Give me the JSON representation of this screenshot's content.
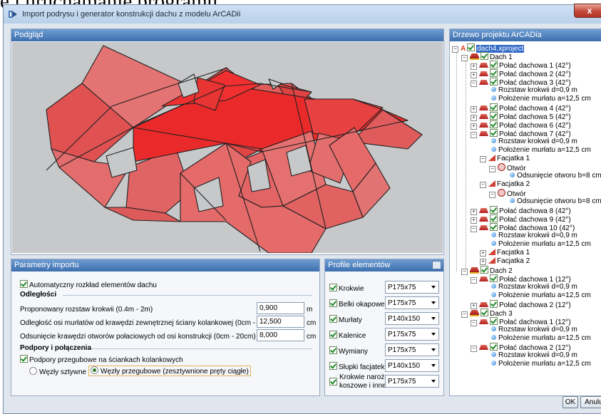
{
  "background_text": "e i urucnamanie programu",
  "window": {
    "title": "Import podrysu i generator konstrukcji dachu z modelu ArCADii",
    "close_label": "x"
  },
  "preview": {
    "title": "Podgląd",
    "colors": {
      "background": "#c7c8ca",
      "roof": "#e21d1d"
    }
  },
  "tree": {
    "title": "Drzewo projektu ArCADia",
    "nodes": [
      {
        "label": "dach4.xproject"
      },
      {
        "label": "Dach 1"
      },
      {
        "label": "Połać dachowa 1 (42°)"
      },
      {
        "label": "Połać dachowa 2 (42°)"
      },
      {
        "label": "Połać dachowa 3 (42°)"
      },
      {
        "label": "Rozstaw krokwii d=0,9 m"
      },
      {
        "label": "Położenie murłatu a=12,5 cm"
      },
      {
        "label": "Połać dachowa 4 (42°)"
      },
      {
        "label": "Połać dachowa 5 (42°)"
      },
      {
        "label": "Połać dachowa 6 (42°)"
      },
      {
        "label": "Połać dachowa 7 (42°)"
      },
      {
        "label": "Rozstaw krokwii d=0,9 m"
      },
      {
        "label": "Położenie murłatu a=12,5 cm"
      },
      {
        "label": "Facjatka 1"
      },
      {
        "label": "Otwór"
      },
      {
        "label": "Odsunięcie otworu b=8 cm"
      },
      {
        "label": "Facjatka 2"
      },
      {
        "label": "Otwór"
      },
      {
        "label": "Odsunięcie otworu b=8 cm"
      },
      {
        "label": "Połać dachowa 8 (42°)"
      },
      {
        "label": "Połać dachowa 9 (42°)"
      },
      {
        "label": "Połać dachowa 10 (42°)"
      },
      {
        "label": "Rozstaw krokwii d=0,9 m"
      },
      {
        "label": "Położenie murłatu a=12,5 cm"
      },
      {
        "label": "Facjatka 1"
      },
      {
        "label": "Facjatka 2"
      },
      {
        "label": "Dach 2"
      },
      {
        "label": "Połać dachowa 1 (12°)"
      },
      {
        "label": "Rozstaw krokwii d=0,9 m"
      },
      {
        "label": "Położenie murłatu a=12,5 cm"
      },
      {
        "label": "Połać dachowa 2 (12°)"
      },
      {
        "label": "Dach 3"
      },
      {
        "label": "Połać dachowa 1 (12°)"
      },
      {
        "label": "Rozstaw krokwii d=0,9 m"
      },
      {
        "label": "Położenie murłatu a=12,5 cm"
      },
      {
        "label": "Połać dachowa 2 (12°)"
      },
      {
        "label": "Rozstaw krokwii d=0,9 m"
      },
      {
        "label": "Położenie murłatu a=12,5 cm"
      }
    ]
  },
  "params": {
    "title": "Parametry importu",
    "auto_layout": "Automatyczny rozkład elementów dachu",
    "distances_heading": "Odległości",
    "rows": [
      {
        "label": "Proponowany rozstaw krokwii (0.4m - 2m)",
        "value": "0,900",
        "unit": "m"
      },
      {
        "label": "Odległość osi murłatów od krawędzi zewnętrznej ściany kolankowej (0cm - 100cm)",
        "value": "12,500",
        "unit": "cm"
      },
      {
        "label": "Odsunięcie krawędzi otworów połaciowych od osi konstrukcji (0cm - 20cm)",
        "value": "8,000",
        "unit": "cm"
      }
    ],
    "supports_heading": "Podpory i połączenia",
    "hinged_supports": "Podpory przegubowe na ściankach kolankowych",
    "radio_rigid": "Węzły sztywne",
    "radio_hinged": "Węzły przegubowe (zesztywnione pręty ciągłe)"
  },
  "profiles": {
    "title": "Profile elementów",
    "items": [
      {
        "label": "Krokwie",
        "value": "P175x75"
      },
      {
        "label": "Belki okapowe",
        "value": "P175x75"
      },
      {
        "label": "Murłaty",
        "value": "P140x150"
      },
      {
        "label": "Kalenice",
        "value": "P175x75"
      },
      {
        "label": "Wymiany",
        "value": "P175x75"
      },
      {
        "label": "Słupki facjatek",
        "value": "P140x150"
      },
      {
        "label": "Krokwie narożne,",
        "label2": "koszowe i inne",
        "value": "P175x75"
      }
    ]
  },
  "footer": {
    "ok": "OK",
    "cancel": "Anuluj"
  }
}
